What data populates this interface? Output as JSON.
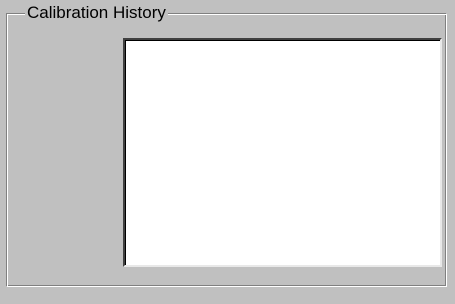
{
  "groupbox": {
    "title": "Calibration History"
  },
  "history_list": {
    "items": []
  }
}
